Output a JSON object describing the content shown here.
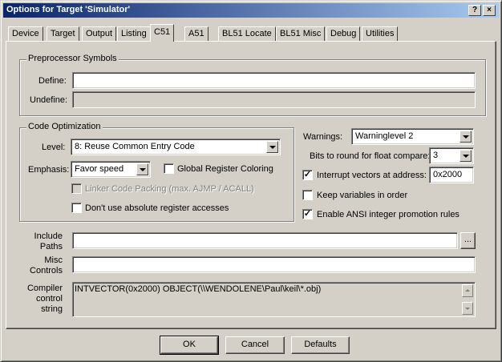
{
  "window": {
    "title": "Options for Target 'Simulator'",
    "help_glyph": "?",
    "close_glyph": "×"
  },
  "tabs": [
    {
      "label": "Device"
    },
    {
      "label": "Target"
    },
    {
      "label": "Output"
    },
    {
      "label": "Listing"
    },
    {
      "label": "C51",
      "active": true
    },
    {
      "label": "A51"
    },
    {
      "label": "BL51 Locate"
    },
    {
      "label": "BL51 Misc"
    },
    {
      "label": "Debug"
    },
    {
      "label": "Utilities"
    }
  ],
  "preprocessor": {
    "title": "Preprocessor Symbols",
    "define_label": "Define:",
    "define_value": "",
    "undefine_label": "Undefine:",
    "undefine_value": ""
  },
  "code_optimization": {
    "title": "Code Optimization",
    "level_label": "Level:",
    "level_value": "8: Reuse Common Entry Code",
    "emphasis_label": "Emphasis:",
    "emphasis_value": "Favor speed",
    "global_register_coloring": {
      "label": "Global Register Coloring",
      "checked": false
    },
    "linker_code_packing": {
      "label": "Linker Code Packing (max. AJMP / ACALL)",
      "checked": false,
      "enabled": false
    },
    "dont_use_absolute": {
      "label": "Don't use absolute register accesses",
      "checked": false
    }
  },
  "right_options": {
    "warnings_label": "Warnings:",
    "warnings_value": "Warninglevel 2",
    "bits_round_label": "Bits to round for float compare:",
    "bits_round_value": "3",
    "interrupt_vectors": {
      "label": "Interrupt vectors at address:",
      "checked": true,
      "value": "0x2000"
    },
    "keep_variables": {
      "label": "Keep variables in order",
      "checked": false
    },
    "enable_ansi": {
      "label": "Enable ANSI integer promotion rules",
      "checked": true
    }
  },
  "paths": {
    "include_label_1": "Include",
    "include_label_2": "Paths",
    "include_value": "",
    "browse_label": "...",
    "misc_label_1": "Misc",
    "misc_label_2": "Controls",
    "misc_value": "",
    "compiler_label_1": "Compiler",
    "compiler_label_2": "control",
    "compiler_label_3": "string",
    "compiler_value": "INTVECTOR(0x2000) OBJECT(\\\\WENDOLENE\\Paul\\keil\\*.obj)"
  },
  "buttons": {
    "ok": "OK",
    "cancel": "Cancel",
    "defaults": "Defaults"
  },
  "check_glyph": "✓"
}
